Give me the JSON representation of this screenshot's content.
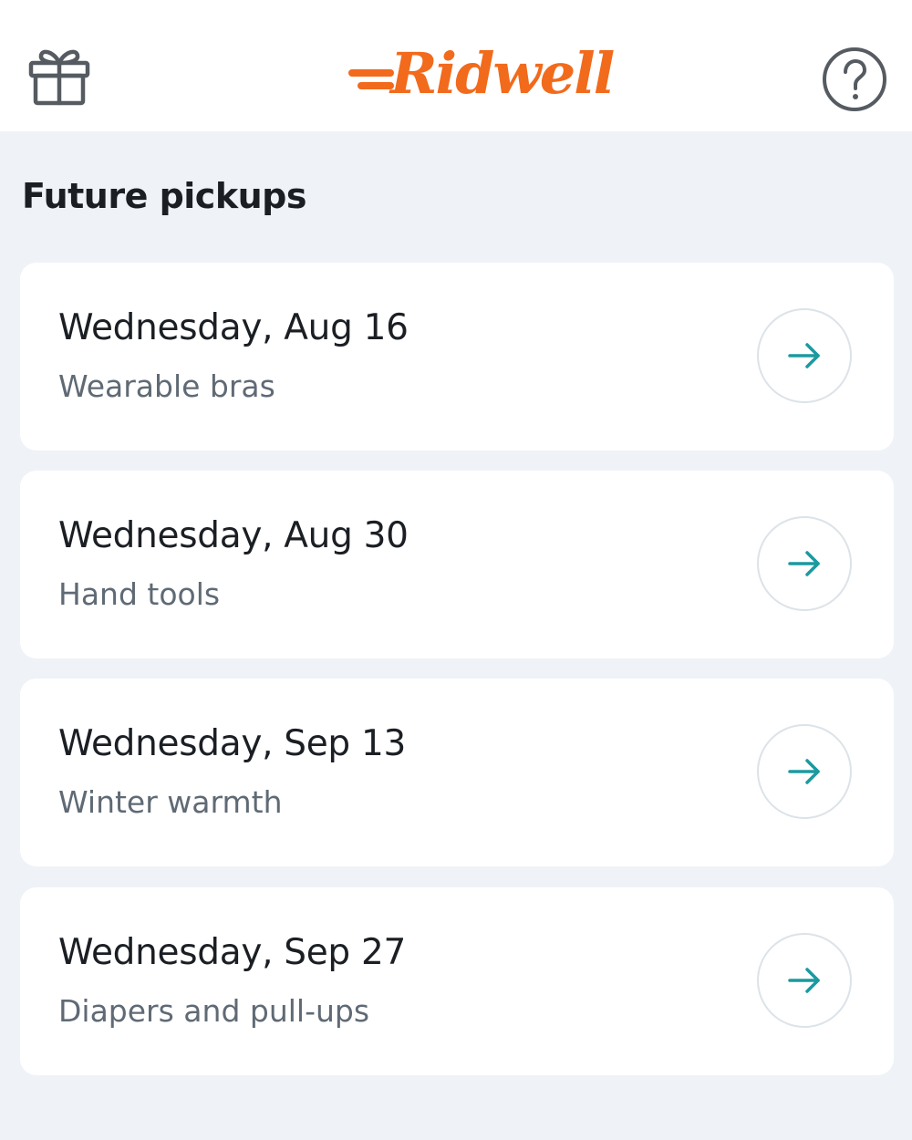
{
  "app": {
    "brand": "Ridwell",
    "brand_color": "#f26a1b",
    "accent_color": "#1a9aa0"
  },
  "header": {
    "left_icon": "gift-icon",
    "right_icon": "help-icon"
  },
  "section": {
    "title": "Future pickups"
  },
  "pickups": [
    {
      "date": "Wednesday, Aug 16",
      "category": "Wearable bras",
      "icon": "arrow-right-icon"
    },
    {
      "date": "Wednesday, Aug 30",
      "category": "Hand tools",
      "icon": "arrow-right-icon"
    },
    {
      "date": "Wednesday, Sep 13",
      "category": "Winter warmth",
      "icon": "arrow-right-icon"
    },
    {
      "date": "Wednesday, Sep 27",
      "category": "Diapers and pull-ups",
      "icon": "arrow-right-icon"
    }
  ]
}
